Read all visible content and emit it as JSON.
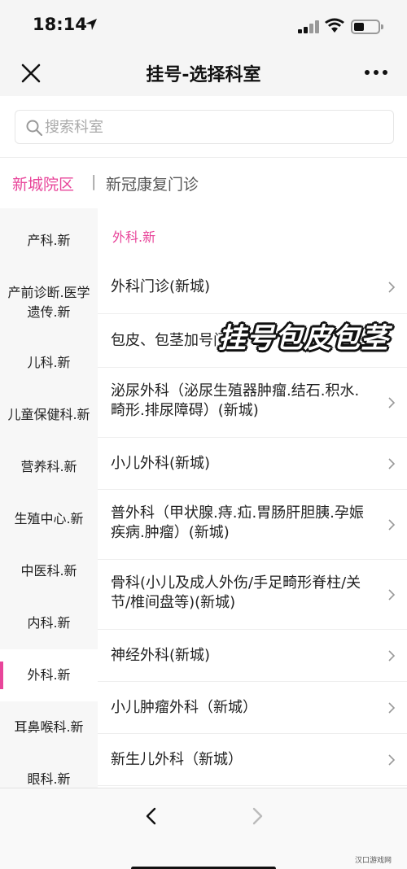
{
  "status_bar": {
    "time": "18:14"
  },
  "nav": {
    "title": "挂号-选择科室"
  },
  "search": {
    "placeholder": "搜索科室"
  },
  "campus": {
    "active": "新城院区",
    "separator": "|",
    "other": "新冠康复门诊"
  },
  "sidebar": {
    "items": [
      {
        "label": "产科.新"
      },
      {
        "label": "产前诊断.医学遗传.新"
      },
      {
        "label": "儿科.新"
      },
      {
        "label": "儿童保健科.新"
      },
      {
        "label": "营养科.新"
      },
      {
        "label": "生殖中心.新"
      },
      {
        "label": "中医科.新"
      },
      {
        "label": "内科.新"
      },
      {
        "label": "外科.新"
      },
      {
        "label": "耳鼻喉科.新"
      },
      {
        "label": "眼科.新"
      }
    ],
    "active_index": 8
  },
  "main": {
    "header": "外科.新",
    "rows": [
      {
        "label": "外科门诊(新城)"
      },
      {
        "label": "包皮、包茎加号门诊"
      },
      {
        "label": "泌尿外科（泌尿生殖器肿瘤.结石.积水.畸形.排尿障碍）(新城)"
      },
      {
        "label": "小儿外科(新城)"
      },
      {
        "label": "普外科（甲状腺.痔.疝.胃肠肝胆胰.孕娠疾病.肿瘤）(新城)"
      },
      {
        "label": "骨科(小儿及成人外伤/手足畸形脊柱/关节/椎间盘等)(新城)"
      },
      {
        "label": "神经外科(新城)"
      },
      {
        "label": "小儿肿瘤外科（新城）"
      },
      {
        "label": "新生儿外科（新城）"
      }
    ]
  },
  "overlay": {
    "watermark": "挂号包皮包茎"
  },
  "footer": {
    "logo": "汉口游戏网"
  },
  "colors": {
    "accent": "#e8459a"
  },
  "icons": [
    "close-icon",
    "more-icon",
    "search-icon",
    "chevron-right-icon",
    "back-arrow-icon",
    "forward-arrow-icon",
    "wifi-icon",
    "signal-icon",
    "battery-icon",
    "location-arrow-icon"
  ]
}
